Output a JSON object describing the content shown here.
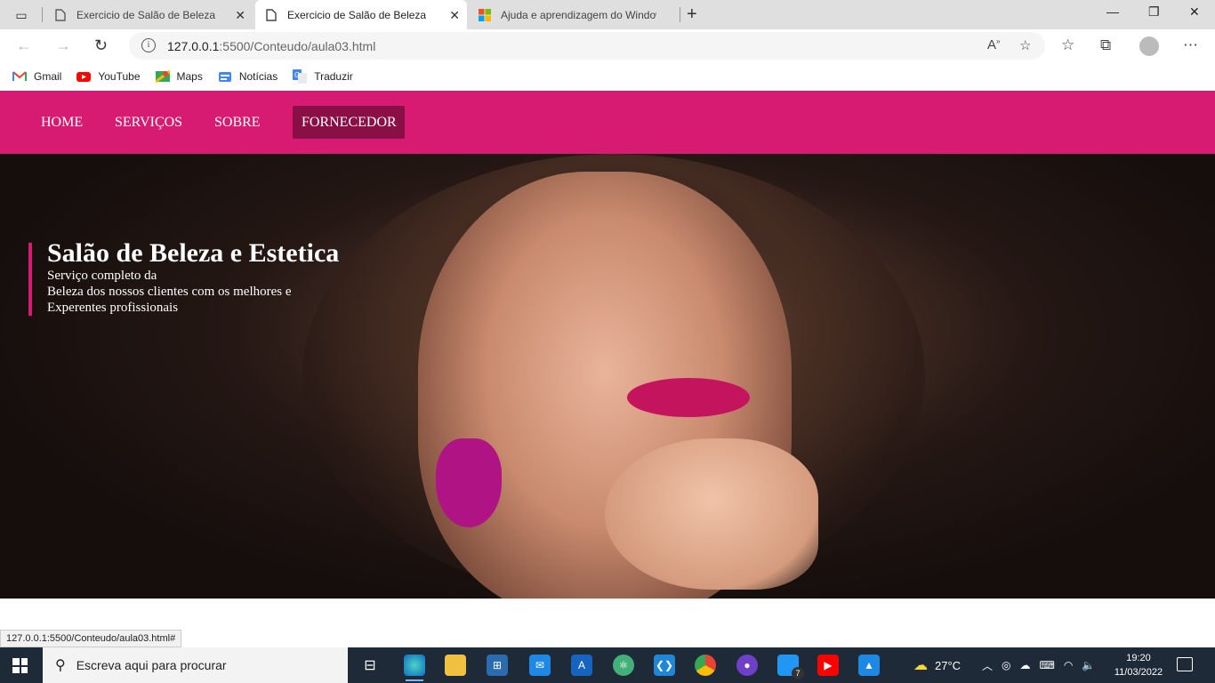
{
  "browser": {
    "tabs": [
      {
        "label": "Exercicio de Salão de Beleza",
        "active": false
      },
      {
        "label": "Exercicio de Salão de Beleza",
        "active": true
      },
      {
        "label": "Ajuda e aprendizagem do Windows",
        "active": false
      }
    ],
    "url_host": "127.0.0.1",
    "url_path": ":5500/Conteudo/aula03.html",
    "bookmarks": [
      "Gmail",
      "YouTube",
      "Maps",
      "Notícias",
      "Traduzir"
    ]
  },
  "site": {
    "nav": [
      "HOME",
      "SERVIÇOS",
      "SOBRE",
      "FORNECEDOR"
    ],
    "active_nav": "FORNECEDOR",
    "hero_title": "Salão de Beleza e Estetica",
    "hero_line1": "Serviço completo da",
    "hero_line2": "Beleza dos nossos clientes com os melhores e",
    "hero_line3": "Experentes profissionais",
    "brand_color": "#d81b72"
  },
  "status_url": "127.0.0.1:5500/Conteudo/aula03.html#",
  "taskbar": {
    "search_placeholder": "Escreva aqui para procurar",
    "weather": "27°C",
    "time": "19:20",
    "date": "11/03/2022",
    "badge_count": "7"
  }
}
